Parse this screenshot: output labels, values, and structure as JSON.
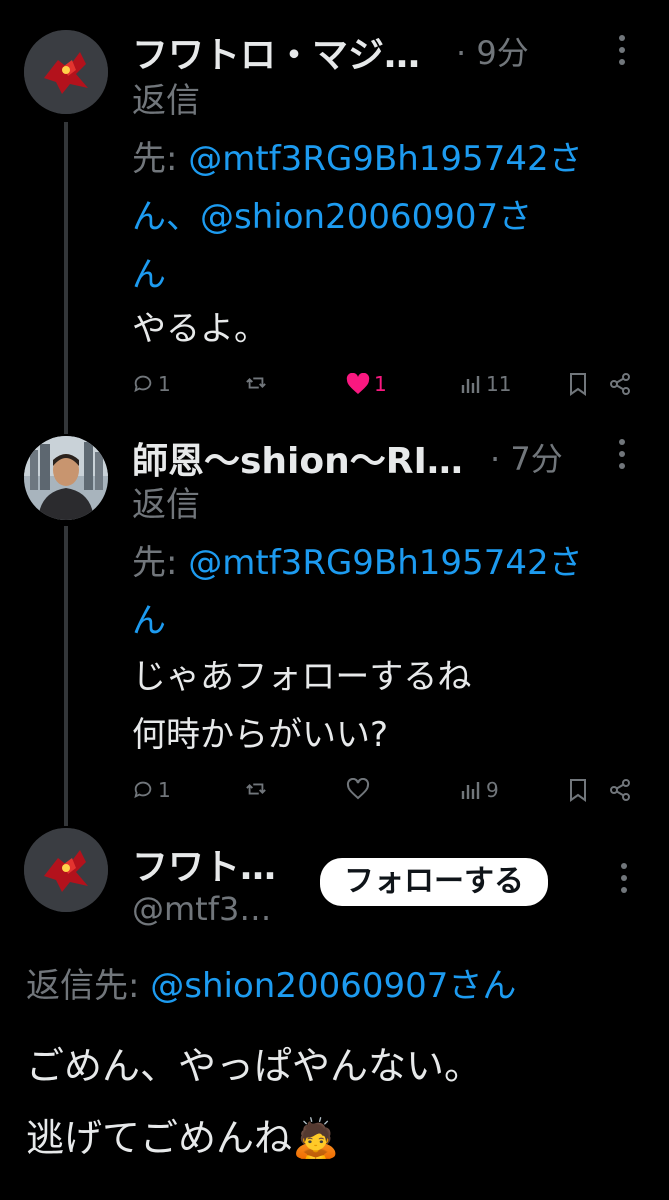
{
  "tweets": [
    {
      "author": "フワトロ・マジ…",
      "separator": "·",
      "time": "9分",
      "reply_prefix_line1": "返信",
      "reply_prefix_line2": "先: ",
      "reply_handle_1": "@mtf3RG9Bh195742さ",
      "reply_handle_1_cont": "ん、@shion20060907さ",
      "reply_handle_1_end": "ん",
      "text": "やるよ。",
      "stats": {
        "replies": "1",
        "retweets": "",
        "likes": "1",
        "views": "11"
      }
    },
    {
      "author": "師恩〜shion〜RI…",
      "separator": "·",
      "time": "7分",
      "reply_prefix_line1": "返信",
      "reply_prefix_line2": "先: ",
      "reply_handle_1": "@mtf3RG9Bh195742さ",
      "reply_handle_1_end": "ん",
      "text_line1": "じゃあフォローするね",
      "text_line2": "何時からがいい?",
      "stats": {
        "replies": "1",
        "retweets": "",
        "likes": "",
        "views": "9"
      }
    }
  ],
  "main_tweet": {
    "author": "フワト…",
    "handle": "@mtf3…",
    "follow_label": "フォローする",
    "reply_prefix": "返信先: ",
    "reply_handle": "@shion20060907さん",
    "text_line1": "ごめん、やっぱやんない。",
    "text_line2": "逃げてごめんね",
    "emoji": "🙇"
  },
  "colors": {
    "background": "#000000",
    "text": "#e7e9ea",
    "muted": "#71767b",
    "link": "#1d9bf0",
    "like": "#f91880"
  }
}
